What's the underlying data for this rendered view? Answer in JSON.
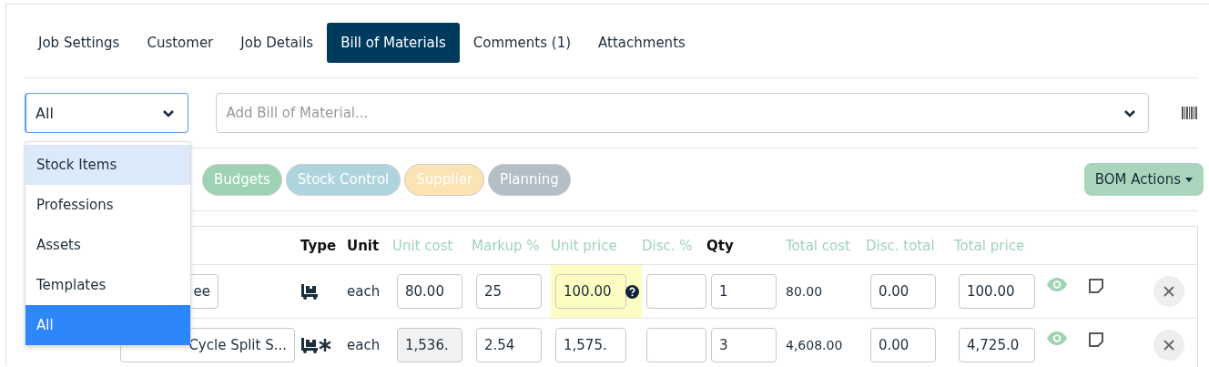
{
  "tabs": [
    {
      "label": "Job Settings",
      "selected": false
    },
    {
      "label": "Customer",
      "selected": false
    },
    {
      "label": "Job Details",
      "selected": false
    },
    {
      "label": "Bill of Materials",
      "selected": true
    },
    {
      "label": "Comments (1)",
      "selected": false
    },
    {
      "label": "Attachments",
      "selected": false
    }
  ],
  "type_filter": {
    "value": "All",
    "options": [
      {
        "label": "Stock Items",
        "selected": false,
        "hovered": true
      },
      {
        "label": "Professions",
        "selected": false,
        "hovered": false
      },
      {
        "label": "Assets",
        "selected": false,
        "hovered": false
      },
      {
        "label": "Templates",
        "selected": false,
        "hovered": false
      },
      {
        "label": "All",
        "selected": true,
        "hovered": false
      }
    ]
  },
  "add_bom": {
    "placeholder": "Add Bill of Material..."
  },
  "tags": [
    {
      "label": "Budgets",
      "color": "#9dd3b3"
    },
    {
      "label": "Stock Control",
      "color": "#aed5de"
    },
    {
      "label": "Supplier",
      "color": "#fbe3b3"
    },
    {
      "label": "Planning",
      "color": "#b4bec6"
    }
  ],
  "bom_actions": "BOM Actions",
  "table": {
    "columns": [
      {
        "label": "Type",
        "accent": false
      },
      {
        "label": "Unit",
        "accent": false
      },
      {
        "label": "Unit cost",
        "accent": true
      },
      {
        "label": "Markup %",
        "accent": true
      },
      {
        "label": "Unit price",
        "accent": true
      },
      {
        "label": "Disc. %",
        "accent": true
      },
      {
        "label": "Qty",
        "accent": false
      },
      {
        "label": "Total cost",
        "accent": true
      },
      {
        "label": "Disc. total",
        "accent": true
      },
      {
        "label": "Total price",
        "accent": true
      }
    ],
    "rows": [
      {
        "name": "ee",
        "starred": false,
        "unit": "each",
        "unit_cost": {
          "value": "80.00",
          "readonly": false
        },
        "markup": "25",
        "unit_price": {
          "value": "100.00",
          "highlighted": true
        },
        "qty": "1",
        "total_cost": "80.00",
        "disc_total": "0.00",
        "total_price": "100.00"
      },
      {
        "name": "Cycle Split S...",
        "starred": true,
        "unit": "each",
        "unit_cost": {
          "value": "1,536.",
          "readonly": true
        },
        "markup": "2.54",
        "unit_price": {
          "value": "1,575.",
          "highlighted": false
        },
        "qty": "3",
        "total_cost": "4,608.00",
        "disc_total": "0.00",
        "total_price": "4,725.0"
      }
    ]
  }
}
